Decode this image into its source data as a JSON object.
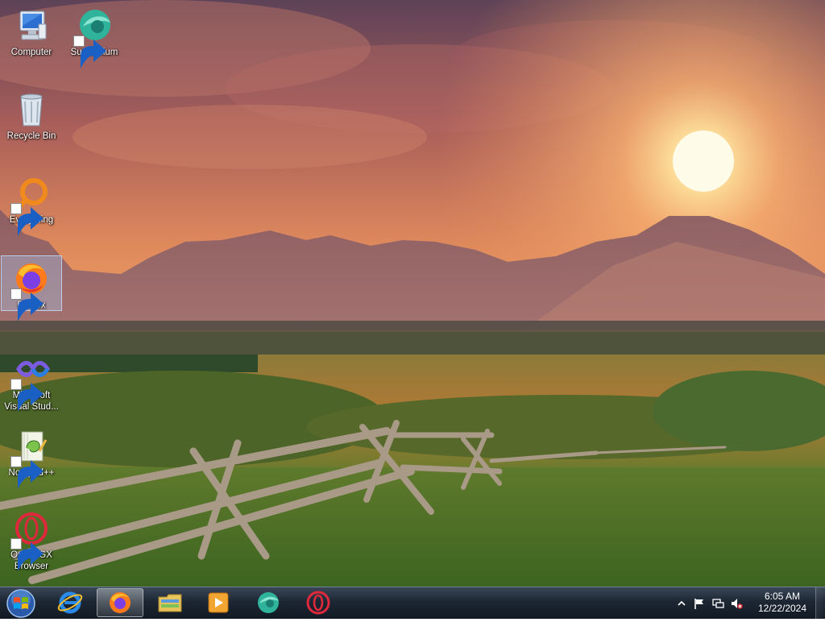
{
  "desktop": {
    "icons": [
      {
        "label": "Computer",
        "icon": "computer-icon",
        "shortcut": false
      },
      {
        "label": "Supermium",
        "icon": "supermium-icon",
        "shortcut": true
      },
      {
        "label": "Recycle Bin",
        "icon": "recycle-bin-icon",
        "shortcut": false
      },
      {
        "label": "Everything",
        "icon": "everything-icon",
        "shortcut": true
      },
      {
        "label": "Firefox",
        "icon": "firefox-icon",
        "shortcut": true,
        "selected": true
      },
      {
        "label": "Microsoft Visual Stud...",
        "icon": "visual-studio-icon",
        "shortcut": true
      },
      {
        "label": "Notepad++",
        "icon": "notepad-plus-plus-icon",
        "shortcut": true
      },
      {
        "label": "Opera GX Browser",
        "icon": "opera-gx-icon",
        "shortcut": true
      }
    ]
  },
  "taskbar": {
    "start": {
      "icon": "windows-start-icon"
    },
    "pinned": [
      {
        "name": "Internet Explorer",
        "icon": "internet-explorer-icon",
        "active": false
      },
      {
        "name": "Firefox",
        "icon": "firefox-icon",
        "active": true
      },
      {
        "name": "Windows Explorer",
        "icon": "file-explorer-icon",
        "active": false
      },
      {
        "name": "Windows Media Player",
        "icon": "media-player-icon",
        "active": false
      },
      {
        "name": "Supermium",
        "icon": "supermium-icon",
        "active": false
      },
      {
        "name": "Opera GX",
        "icon": "opera-gx-icon",
        "active": false
      }
    ],
    "tray": {
      "icons": [
        "show-hidden-icons-chevron",
        "action-center-flag-icon",
        "network-icon",
        "volume-muted-icon"
      ],
      "time": "6:05 AM",
      "date": "12/22/2024"
    }
  },
  "colors": {
    "taskbar_top": "#3a4757",
    "taskbar_bottom": "#111a24",
    "sky_top": "#6b4a5e",
    "sun": "#fff2c8"
  }
}
